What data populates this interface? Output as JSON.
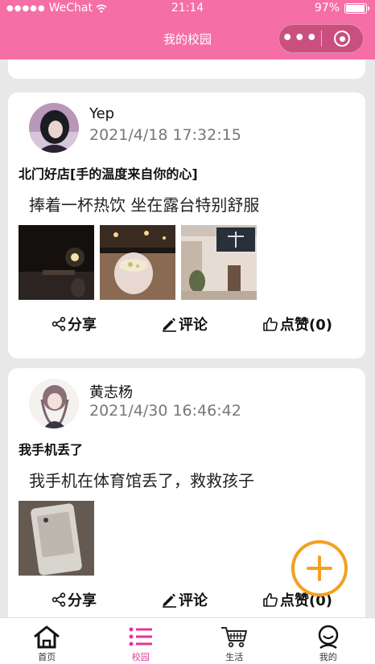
{
  "status_bar": {
    "carrier": "WeChat",
    "time": "21:14",
    "battery": "97%"
  },
  "nav": {
    "title": "我的校园"
  },
  "posts": [
    {
      "username": "Yep",
      "time": "2021/4/18 17:32:15",
      "title": "北门好店[手的温度来自你的心]",
      "content": "捧着一杯热饮 坐在露台特别舒服",
      "actions": {
        "share": "分享",
        "comment": "评论",
        "like": "点赞(0)"
      }
    },
    {
      "username": "黄志杨",
      "time": "2021/4/30 16:46:42",
      "title": "我手机丢了",
      "content": "我手机在体育馆丢了，救救孩子",
      "actions": {
        "share": "分享",
        "comment": "评论",
        "like": "点赞(0)"
      }
    }
  ],
  "tabbar": {
    "items": [
      {
        "label": "首页",
        "icon": "home-icon"
      },
      {
        "label": "校园",
        "icon": "list-icon"
      },
      {
        "label": "生活",
        "icon": "cart-icon"
      },
      {
        "label": "我的",
        "icon": "profile-icon"
      }
    ],
    "active_color": "#e5359a"
  },
  "colors": {
    "header": "#f56fa6",
    "fab": "#f2a11f"
  }
}
